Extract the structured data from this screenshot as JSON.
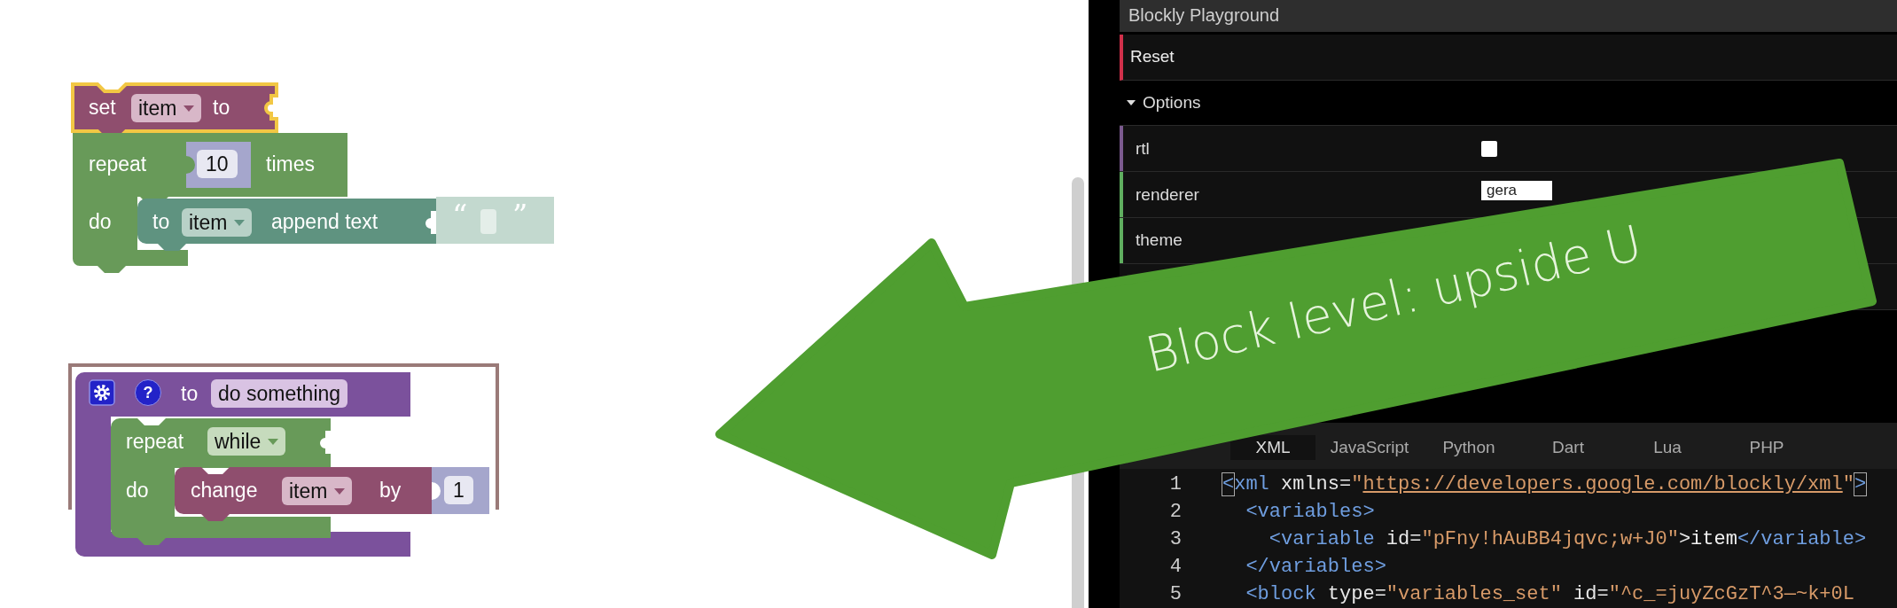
{
  "workspace": {
    "stack_1": {
      "set": {
        "keyword": "set",
        "variable": "item",
        "suffix": "to",
        "selected": true
      },
      "repeat": {
        "keyword": "repeat",
        "count": "10",
        "suffix": "times",
        "do": "do"
      },
      "append": {
        "keyword": "to",
        "variable": "item",
        "action": "append text",
        "open_quote": "“",
        "close_quote": "”"
      }
    },
    "stack_2": {
      "procedure": {
        "help": "?",
        "keyword": "to",
        "name": "do something"
      },
      "loop": {
        "keyword": "repeat",
        "mode": "while",
        "do": "do"
      },
      "change": {
        "keyword": "change",
        "variable": "item",
        "by": "by",
        "value": "1"
      }
    }
  },
  "panel": {
    "title": "Blockly Playground",
    "reset": "Reset",
    "options": {
      "label": "Options",
      "expanded": true,
      "rows": [
        {
          "kind": "checkbox",
          "label": "rtl",
          "checked": false,
          "color": "#7b5a8e"
        },
        {
          "kind": "select",
          "label": "renderer",
          "value": "gera",
          "color": "#5fae5f"
        },
        {
          "kind": "select",
          "label": "theme",
          "color": "#5fae5f"
        }
      ]
    },
    "tabs": [
      {
        "label": "XML",
        "selected": true
      },
      {
        "label": "JavaScript",
        "selected": false
      },
      {
        "label": "Python",
        "selected": false
      },
      {
        "label": "Dart",
        "selected": false
      },
      {
        "label": "Lua",
        "selected": false
      },
      {
        "label": "PHP",
        "selected": false
      }
    ],
    "code": [
      {
        "number": "1",
        "parts": [
          {
            "kind": "bracket",
            "text": "<"
          },
          {
            "kind": "tag",
            "text": "xml"
          },
          {
            "kind": "attr",
            "text": " xmlns"
          },
          {
            "kind": "punct",
            "text": "="
          },
          {
            "kind": "string",
            "text": "\""
          },
          {
            "kind": "link",
            "text": "https://developers.google.com/blockly/xml"
          },
          {
            "kind": "string",
            "text": "\""
          },
          {
            "kind": "bracket",
            "text": ">"
          }
        ]
      },
      {
        "number": "2",
        "parts": [
          {
            "kind": "tag",
            "text": "  <variables>"
          }
        ]
      },
      {
        "number": "3",
        "parts": [
          {
            "kind": "tag",
            "text": "    <variable"
          },
          {
            "kind": "attr",
            "text": " id"
          },
          {
            "kind": "punct",
            "text": "="
          },
          {
            "kind": "string",
            "text": "\"pFny!hAuBB4jqvc;w+J0\""
          },
          {
            "kind": "punct",
            "text": ">"
          },
          {
            "kind": "text",
            "text": "item"
          },
          {
            "kind": "tag",
            "text": "</variable>"
          }
        ]
      },
      {
        "number": "4",
        "parts": [
          {
            "kind": "tag",
            "text": "  </variables>"
          }
        ]
      },
      {
        "number": "5",
        "parts": [
          {
            "kind": "tag",
            "text": "  <block"
          },
          {
            "kind": "attr",
            "text": " type"
          },
          {
            "kind": "punct",
            "text": "="
          },
          {
            "kind": "string",
            "text": "\"variables_set\""
          },
          {
            "kind": "attr",
            "text": " id"
          },
          {
            "kind": "punct",
            "text": "="
          },
          {
            "kind": "string",
            "text": "\"^c_=juyZcGzT^3—~k+0L"
          }
        ]
      }
    ]
  },
  "callout": {
    "text": "Block level: upside U"
  }
}
